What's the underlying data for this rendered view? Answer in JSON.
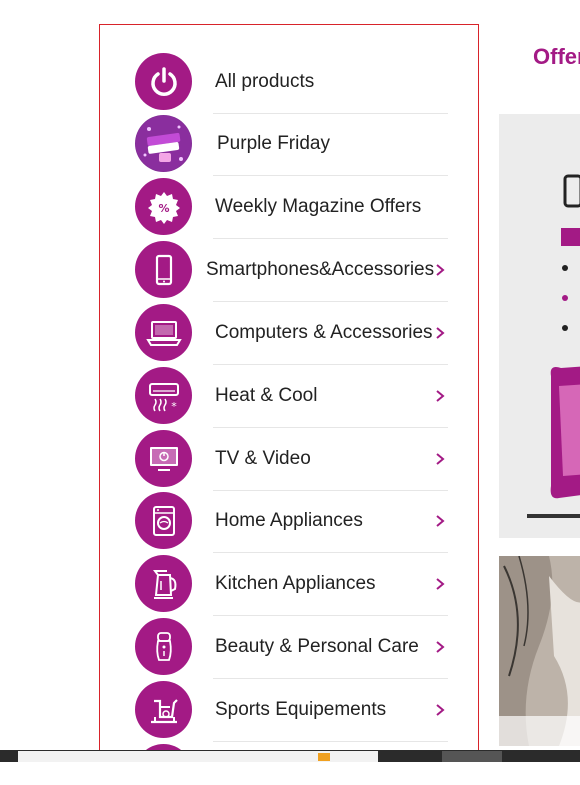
{
  "offers_heading": "Offer",
  "menu": [
    {
      "label": "All products",
      "icon": "power-icon",
      "chevron": false
    },
    {
      "label": "Purple Friday",
      "icon": "purple-friday-badge-icon",
      "chevron": false
    },
    {
      "label": "Weekly Magazine Offers",
      "icon": "percent-badge-icon",
      "chevron": false
    },
    {
      "label": "Smartphones&Accessories",
      "icon": "smartphone-icon",
      "chevron": true
    },
    {
      "label": "Computers & Accessories",
      "icon": "laptop-icon",
      "chevron": true
    },
    {
      "label": "Heat & Cool",
      "icon": "air-conditioner-icon",
      "chevron": true
    },
    {
      "label": "TV & Video",
      "icon": "tv-icon",
      "chevron": true
    },
    {
      "label": "Home Appliances",
      "icon": "washing-machine-icon",
      "chevron": true
    },
    {
      "label": "Kitchen Appliances",
      "icon": "kettle-icon",
      "chevron": true
    },
    {
      "label": "Beauty & Personal Care",
      "icon": "shaver-icon",
      "chevron": true
    },
    {
      "label": "Sports Equipements",
      "icon": "exercise-bike-icon",
      "chevron": true
    }
  ],
  "colors": {
    "brand": "#a31a85",
    "border": "#d8232a"
  }
}
